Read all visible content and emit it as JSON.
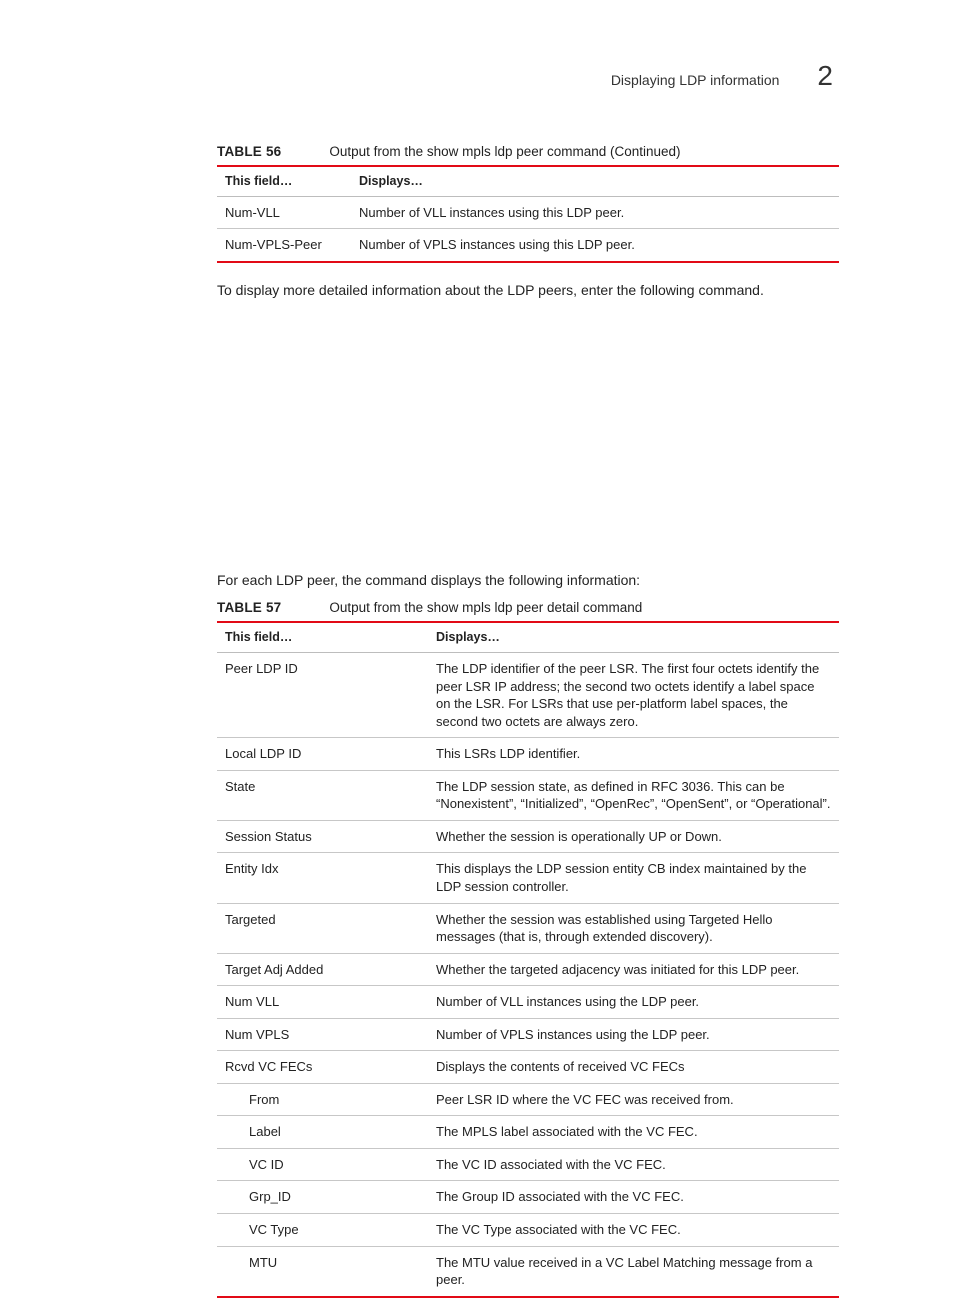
{
  "header": {
    "section_title": "Displaying LDP information",
    "chapter_number": "2"
  },
  "table56": {
    "label": "TABLE 56",
    "title": "Output from the show mpls ldp peer command  (Continued)",
    "head_field": "This field…",
    "head_displays": "Displays…",
    "rows": [
      {
        "field": "Num-VLL",
        "desc": "Number of VLL instances using this LDP peer."
      },
      {
        "field": "Num-VPLS-Peer",
        "desc": "Number of VPLS instances using this LDP peer."
      }
    ]
  },
  "para1": "To display more detailed information about the LDP peers, enter the following command.",
  "para2": "For each LDP peer, the command displays the following information:",
  "table57": {
    "label": "TABLE 57",
    "title": "Output from the show mpls ldp peer detail command",
    "head_field": "This field…",
    "head_displays": "Displays…",
    "rows": [
      {
        "field": "Peer LDP ID",
        "indent": 0,
        "desc": "The LDP identifier of the peer LSR. The first four octets identify the peer LSR IP address; the second two octets identify a label space on the LSR. For LSRs that use per-platform label spaces, the second two octets are always zero."
      },
      {
        "field": "Local LDP ID",
        "indent": 0,
        "desc": "This LSRs LDP identifier."
      },
      {
        "field": "State",
        "indent": 0,
        "desc": "The LDP session state, as defined in RFC 3036. This can be “Nonexistent”, “Initialized”, “OpenRec”, “OpenSent”, or “Operational”."
      },
      {
        "field": "Session Status",
        "indent": 0,
        "desc": "Whether the session is operationally UP or Down."
      },
      {
        "field": "Entity Idx",
        "indent": 0,
        "desc": "This displays the LDP session entity CB index maintained by the LDP session controller."
      },
      {
        "field": "Targeted",
        "indent": 0,
        "desc": "Whether the session was established using Targeted Hello messages (that is, through extended discovery)."
      },
      {
        "field": "Target Adj Added",
        "indent": 0,
        "desc": "Whether the targeted adjacency was initiated for this LDP peer."
      },
      {
        "field": "Num VLL",
        "indent": 0,
        "desc": "Number of VLL instances using the LDP peer."
      },
      {
        "field": "Num VPLS",
        "indent": 0,
        "desc": "Number of VPLS instances using the LDP peer."
      },
      {
        "field": "Rcvd VC FECs",
        "indent": 0,
        "desc": "Displays the contents of received VC FECs"
      },
      {
        "field": "From",
        "indent": 1,
        "desc": "Peer LSR ID where the VC FEC was received from."
      },
      {
        "field": "Label",
        "indent": 1,
        "desc": "The MPLS label associated with the VC FEC."
      },
      {
        "field": "VC ID",
        "indent": 1,
        "desc": "The VC ID associated with the VC FEC."
      },
      {
        "field": "Grp_ID",
        "indent": 1,
        "desc": "The Group ID associated with the VC FEC."
      },
      {
        "field": "VC Type",
        "indent": 1,
        "desc": "The VC Type associated with the VC FEC."
      },
      {
        "field": "MTU",
        "indent": 1,
        "desc": "The MTU value received in a VC Label Matching message from a peer."
      }
    ]
  }
}
